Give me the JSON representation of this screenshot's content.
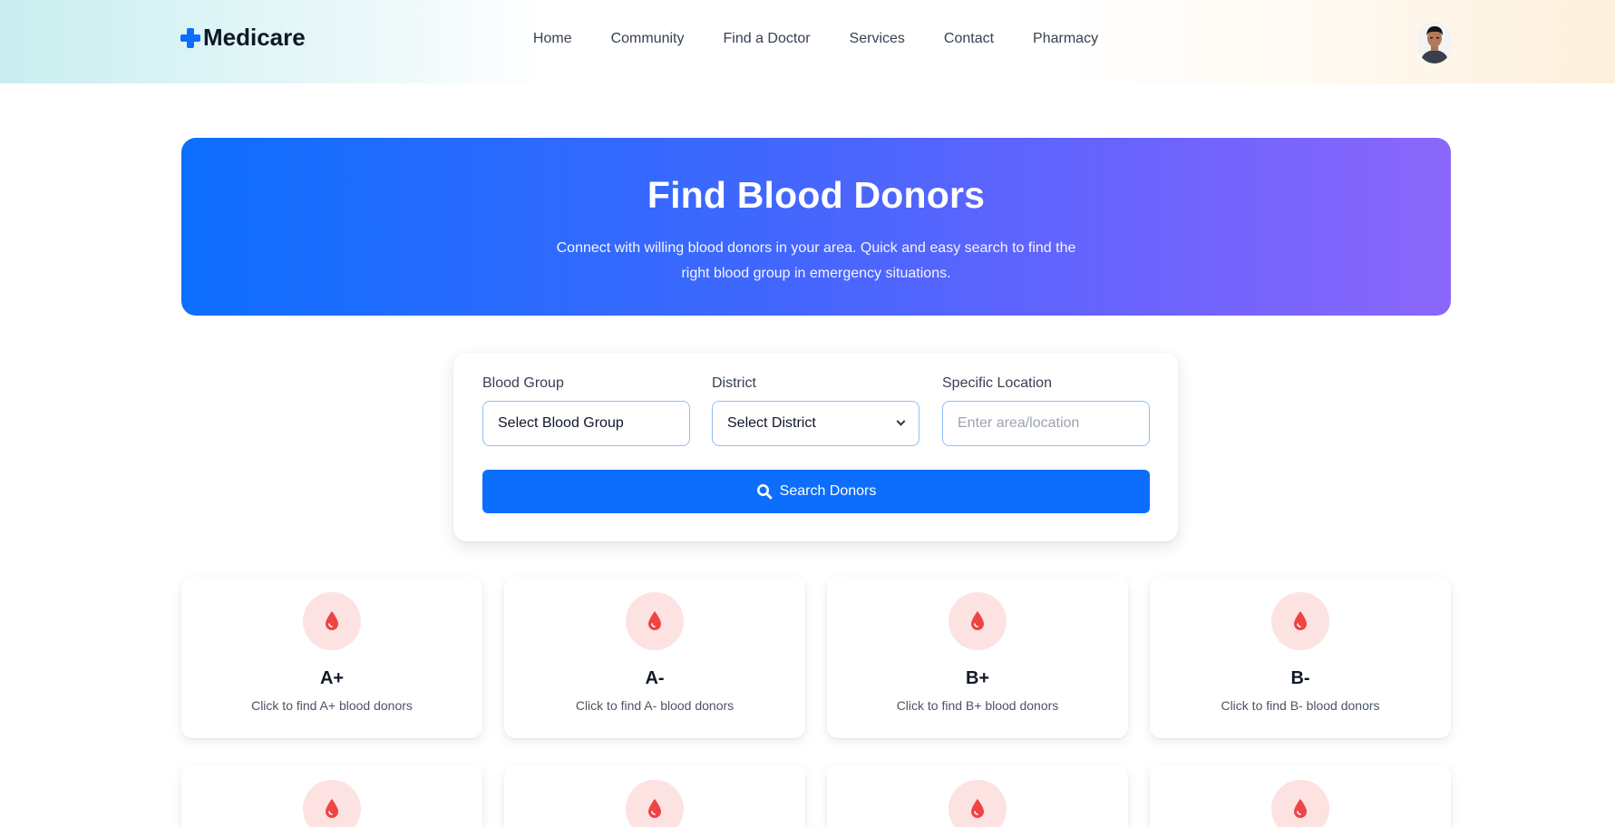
{
  "header": {
    "logo_text": "Medicare",
    "nav": [
      "Home",
      "Community",
      "Find a Doctor",
      "Services",
      "Contact",
      "Pharmacy"
    ]
  },
  "hero": {
    "title": "Find Blood Donors",
    "subtitle": "Connect with willing blood donors in your area. Quick and easy search to find the right blood group in emergency situations."
  },
  "search": {
    "blood_group_label": "Blood Group",
    "blood_group_value": "Select Blood Group",
    "district_label": "District",
    "district_value": "Select District",
    "location_label": "Specific Location",
    "location_placeholder": "Enter area/location",
    "button_label": "Search Donors"
  },
  "blood_groups": [
    {
      "name": "A+",
      "desc": "Click to find A+ blood donors"
    },
    {
      "name": "A-",
      "desc": "Click to find A- blood donors"
    },
    {
      "name": "B+",
      "desc": "Click to find B+ blood donors"
    },
    {
      "name": "B-",
      "desc": "Click to find B- blood donors"
    }
  ],
  "colors": {
    "primary": "#0d6efd",
    "drop_red": "#ef4444",
    "drop_bg": "#fde2e2"
  }
}
